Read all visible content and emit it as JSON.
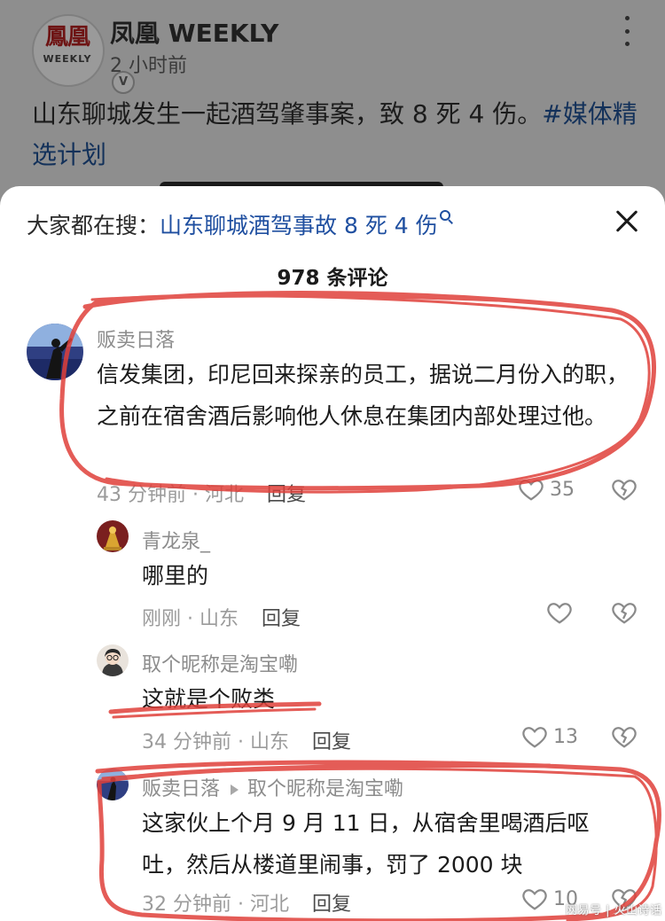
{
  "post": {
    "logo_text": "鳳凰",
    "logo_sub": "WEEKLY",
    "verified_mark": "V",
    "author": "凤凰 WEEKLY",
    "time": "2 小时前",
    "text": "山东聊城发生一起酒驾肇事案，致 8 死 4 伤。",
    "tag": "#媒体精选计划"
  },
  "sheet": {
    "search_prefix": "大家都在搜：",
    "search_query": "山东聊城酒驾事故 8 死 4 伤",
    "comment_count": "978 条评论"
  },
  "comments": [
    {
      "author": "贩卖日落",
      "text": "信发集团，印尼回来探亲的员工，据说二月份入的职，之前在宿舍酒后影响他人休息在集团内部处理过他。",
      "meta": "43 分钟前 · 河北",
      "reply_label": "回复",
      "likes": "35"
    },
    {
      "author": "青龙泉_",
      "text": "哪里的",
      "meta": "刚刚 · 山东",
      "reply_label": "回复",
      "likes": ""
    },
    {
      "author": "取个昵称是淘宝嘞",
      "text": "这就是个败类",
      "meta": "34 分钟前 · 山东",
      "reply_label": "回复",
      "likes": "13"
    },
    {
      "author": "贩卖日落",
      "reply_to": "取个昵称是淘宝嘞",
      "text": "这家伙上个月 9 月 11 日，从宿舍里喝酒后呕吐，然后从楼道里闹事，罚了 2000 块",
      "meta": "32 分钟前 · 河北",
      "reply_label": "回复",
      "likes": "10"
    }
  ],
  "watermark": "网易号 | 火山诗话",
  "icons": {
    "like": "heart-icon",
    "dislike": "broken-heart-icon",
    "close": "close-icon",
    "search": "search-icon",
    "more": "more-vertical-icon"
  },
  "colors": {
    "accent_link": "#1f4fa0",
    "annotation_red": "#e0403a",
    "overlay_dim": "#8e8e8e"
  }
}
